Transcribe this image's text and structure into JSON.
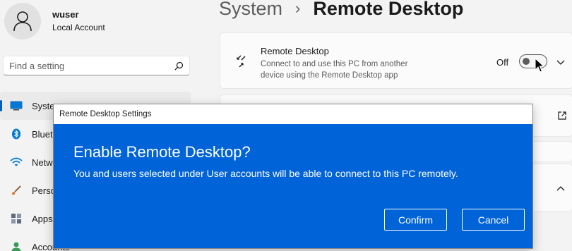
{
  "account": {
    "name": "wuser",
    "type": "Local Account"
  },
  "search": {
    "placeholder": "Find a setting",
    "icon": "search-icon"
  },
  "sidebar": {
    "items": [
      {
        "label": "System",
        "icon": "monitor-icon",
        "active": true
      },
      {
        "label": "Bluetooth & devices",
        "icon": "bluetooth-icon"
      },
      {
        "label": "Network & internet",
        "icon": "wifi-icon"
      },
      {
        "label": "Personalization",
        "icon": "brush-icon"
      },
      {
        "label": "Apps",
        "icon": "apps-icon"
      },
      {
        "label": "Accounts",
        "icon": "person-icon"
      }
    ]
  },
  "breadcrumb": {
    "parent": "System",
    "separator": "›",
    "current": "Remote Desktop"
  },
  "remote_desktop_card": {
    "title": "Remote Desktop",
    "description": "Connect to and use this PC from another device using the Remote Desktop app",
    "toggle_state": "Off"
  },
  "dialog": {
    "window_title": "Remote Desktop Settings",
    "heading": "Enable Remote Desktop?",
    "message": "You and users selected under User accounts will be able to connect to this PC remotely.",
    "confirm_label": "Confirm",
    "cancel_label": "Cancel",
    "background_color": "#0063d7"
  },
  "colors": {
    "accent": "#005fb8",
    "dialog_blue": "#0063d7",
    "page_bg": "#f3f3f3"
  }
}
